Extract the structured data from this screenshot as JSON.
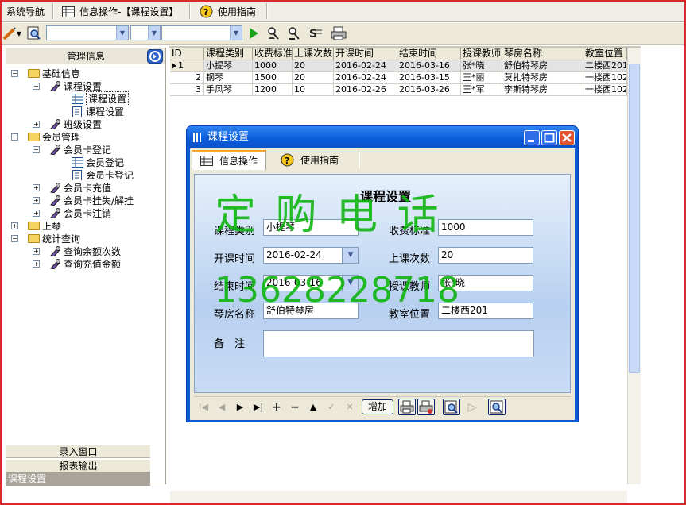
{
  "top_tabs": {
    "nav": "系统导航",
    "info": "信息操作-【课程设置】",
    "guide": "使用指南"
  },
  "left": {
    "header": "管理信息",
    "tree": {
      "basic": "基础信息",
      "course": "课程设置",
      "course_a": "课程设置",
      "course_b": "课程设置",
      "class": "班级设置",
      "member": "会员管理",
      "card_reg": "会员卡登记",
      "card_reg_a": "会员登记",
      "card_reg_b": "会员卡登记",
      "recharge": "会员卡充值",
      "lost": "会员卡挂失/解挂",
      "cancel": "会员卡注销",
      "lesson": "上琴",
      "stats": "统计查询",
      "q_balance": "查询余额次数",
      "q_amount": "查询充值金额"
    },
    "buttons": {
      "entry": "录入窗口",
      "report": "报表输出"
    },
    "caption": "课程设置"
  },
  "grid": {
    "columns": [
      "ID",
      "课程类别",
      "收费标准",
      "上课次数",
      "开课时间",
      "结束时间",
      "授课教师",
      "琴房名称",
      "教室位置"
    ],
    "rows": [
      [
        "1",
        "小提琴",
        "1000",
        "20",
        "2016-02-24",
        "2016-03-16",
        "张*晓",
        "舒伯特琴房",
        "二楼西201"
      ],
      [
        "2",
        "钢琴",
        "1500",
        "20",
        "2016-02-24",
        "2016-03-15",
        "王*丽",
        "莫扎特琴房",
        "一楼西102"
      ],
      [
        "3",
        "手风琴",
        "1200",
        "10",
        "2016-02-26",
        "2016-03-26",
        "王*军",
        "李斯特琴房",
        "一楼西102"
      ]
    ]
  },
  "dialog": {
    "title": "课程设置",
    "tab_info": "信息操作",
    "tab_guide": "使用指南",
    "form_title": "课程设置",
    "labels": {
      "category": "课程类别",
      "fee": "收费标准",
      "start": "开课时间",
      "sessions": "上课次数",
      "end": "结束时间",
      "teacher": "授课教师",
      "room": "琴房名称",
      "location": "教室位置",
      "remark": "备　注"
    },
    "values": {
      "category": "小提琴",
      "fee": "1000",
      "start": "2016-02-24",
      "sessions": "20",
      "end": "2016-03-16",
      "teacher": "张*晓",
      "room": "舒伯特琴房",
      "location": "二楼西201",
      "remark": ""
    },
    "add_label": "增加"
  },
  "watermark": {
    "line1": "定 购 电 话",
    "line2": "13628228718"
  },
  "colors": {
    "frame": "#d92a2a",
    "title_bar": "#0a5ad9",
    "watermark": "#0fb60f"
  }
}
